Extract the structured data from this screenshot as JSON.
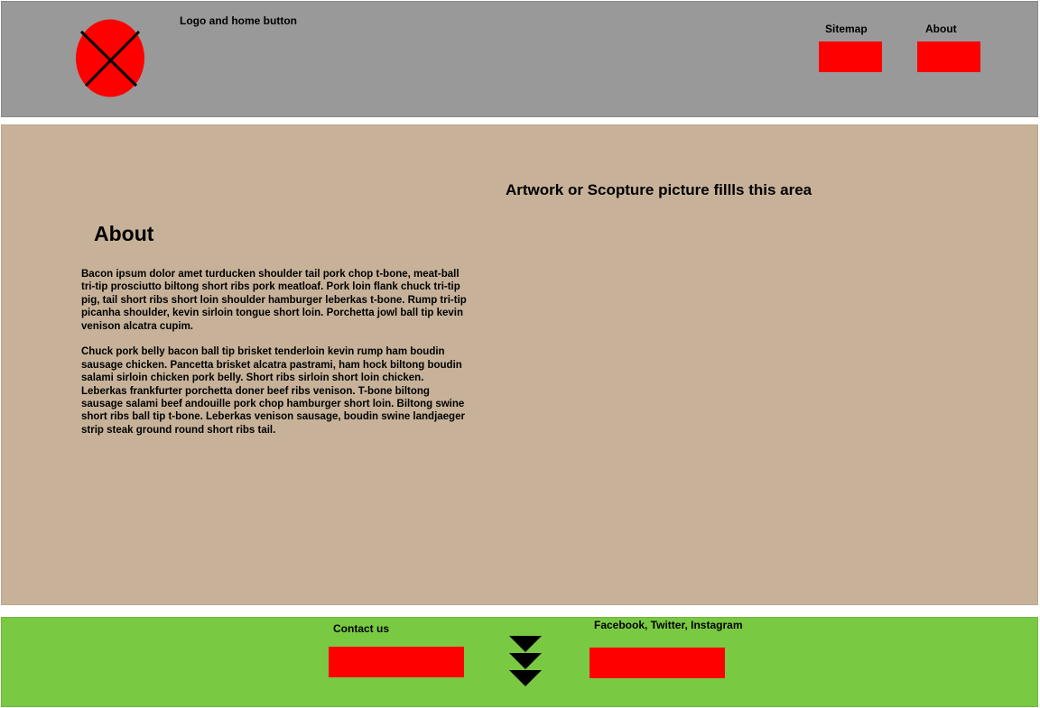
{
  "header": {
    "logo_icon": "circle-x-icon",
    "logo_label": "Logo and home button",
    "nav": {
      "sitemap_label": "Sitemap",
      "about_label": "About"
    }
  },
  "main": {
    "artwork_label": "Artwork or Scopture picture fillls this area",
    "about_title": "About",
    "paragraphs": [
      "Bacon ipsum dolor amet turducken shoulder tail pork chop t-bone, meat-ball tri-tip prosciutto biltong short ribs pork meatloaf. Pork loin flank chuck tri-tip pig, tail short ribs short loin shoulder hamburger leberkas t-bone. Rump tri-tip picanha shoulder, kevin sirloin tongue short loin. Porchetta jowl ball tip kevin venison alcatra cupim.",
      "Chuck pork belly bacon ball tip brisket tenderloin kevin rump ham boudin sausage chicken. Pancetta brisket alcatra pastrami, ham hock biltong boudin salami sirloin chicken pork belly. Short ribs sirloin short loin chicken. Leberkas frankfurter porchetta doner beef ribs venison. T-bone biltong sausage salami beef andouille pork chop hamburger short loin. Biltong swine short ribs ball tip t-bone. Leberkas venison sausage, boudin swine landjaeger strip steak ground round short ribs tail."
    ]
  },
  "footer": {
    "contact_label": "Contact us",
    "social_label": "Facebook, Twitter, Instagram",
    "scroll_icon": "triple-chevron-down-icon"
  },
  "colors": {
    "header_bg": "#999999",
    "main_bg": "#c7b299",
    "footer_bg": "#7ac943",
    "placeholder_red": "#ff0000"
  }
}
